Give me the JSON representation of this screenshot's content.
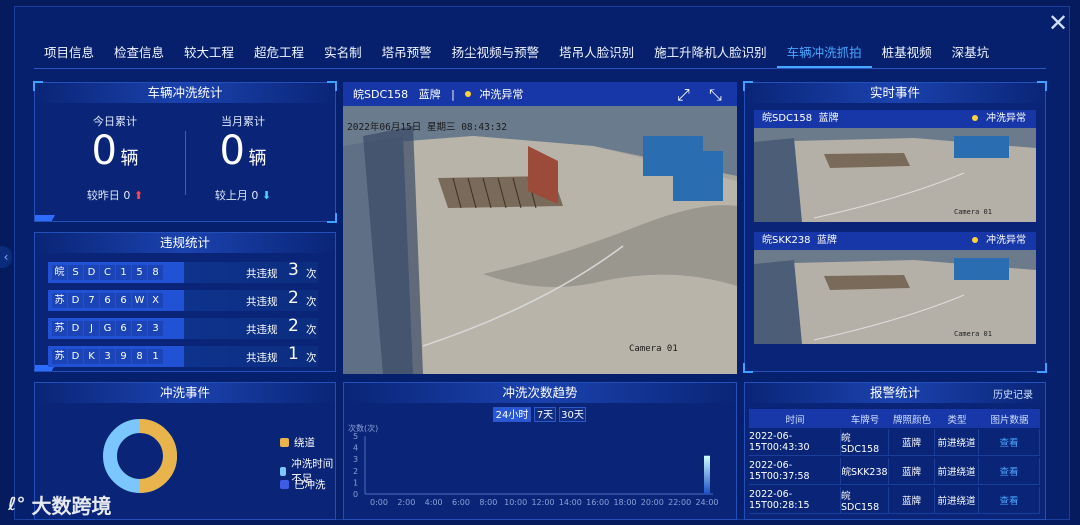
{
  "tabs": [
    "项目信息",
    "检查信息",
    "较大工程",
    "超危工程",
    "实名制",
    "塔吊预警",
    "扬尘视频与预警",
    "塔吊人脸识别",
    "施工升降机人脸识别",
    "车辆冲洗抓拍",
    "桩基视频",
    "深基坑"
  ],
  "active_tab": "车辆冲洗抓拍",
  "wash_stats": {
    "title": "车辆冲洗统计",
    "today_label": "今日累计",
    "today_value": "0",
    "month_label": "当月累计",
    "month_value": "0",
    "unit": "辆",
    "vs_yesterday": "较昨日 0",
    "vs_last_month": "较上月 0"
  },
  "violations": {
    "title": "违规统计",
    "total_label": "共违规",
    "unit": "次",
    "rows": [
      {
        "plate": [
          "皖",
          "S",
          "D",
          "C",
          "1",
          "5",
          "8"
        ],
        "count": "3"
      },
      {
        "plate": [
          "苏",
          "D",
          "7",
          "6",
          "6",
          "W",
          "X"
        ],
        "count": "2"
      },
      {
        "plate": [
          "苏",
          "D",
          "J",
          "G",
          "6",
          "2",
          "3"
        ],
        "count": "2"
      },
      {
        "plate": [
          "苏",
          "D",
          "K",
          "3",
          "9",
          "8",
          "1"
        ],
        "count": "1"
      }
    ]
  },
  "camera": {
    "plate": "皖SDC158",
    "color": "蓝牌",
    "sep": "|",
    "status": "冲洗异常",
    "timestamp": "2022年06月15日 星期三 08:43:32",
    "camera_label": "Camera 01"
  },
  "realtime": {
    "title": "实时事件",
    "events": [
      {
        "plate": "皖SDC158",
        "color": "蓝牌",
        "status": "冲洗异常",
        "cam": "Camera 01"
      },
      {
        "plate": "皖SKK238",
        "color": "蓝牌",
        "status": "冲洗异常",
        "cam": "Camera 01"
      }
    ]
  },
  "wash_events": {
    "title": "冲洗事件",
    "legend": [
      "绕道",
      "冲洗时间不足",
      "已冲洗"
    ],
    "colors": [
      "#e9b44c",
      "#7cc6ff",
      "#3f5ce6"
    ]
  },
  "trend": {
    "title": "冲洗次数趋势",
    "buttons": [
      "24小时",
      "7天",
      "30天"
    ],
    "active_button": "24小时"
  },
  "chart_data": {
    "type": "bar",
    "ylabel": "次数(次)",
    "ylim": [
      0,
      5
    ],
    "yticks": [
      "5",
      "4",
      "3",
      "2",
      "1",
      "0"
    ],
    "categories": [
      "0:00",
      "2:00",
      "4:00",
      "6:00",
      "8:00",
      "10:00",
      "12:00",
      "14:00",
      "16:00",
      "18:00",
      "20:00",
      "22:00",
      "24:00"
    ],
    "values": [
      0,
      0,
      0,
      0,
      0,
      0,
      0,
      0,
      0,
      0,
      0,
      0,
      3
    ]
  },
  "alarms": {
    "title": "报警统计",
    "history_link": "历史记录",
    "columns": [
      "时间",
      "车牌号",
      "牌照颜色",
      "类型",
      "图片数据"
    ],
    "rows": [
      [
        "2022-06-15T00:43:30",
        "皖SDC158",
        "蓝牌",
        "前进绕道",
        "查看"
      ],
      [
        "2022-06-15T00:37:58",
        "皖SKK238",
        "蓝牌",
        "前进绕道",
        "查看"
      ],
      [
        "2022-06-15T00:28:15",
        "皖SDC158",
        "蓝牌",
        "前进绕道",
        "查看"
      ]
    ]
  },
  "watermark": "大数跨境"
}
